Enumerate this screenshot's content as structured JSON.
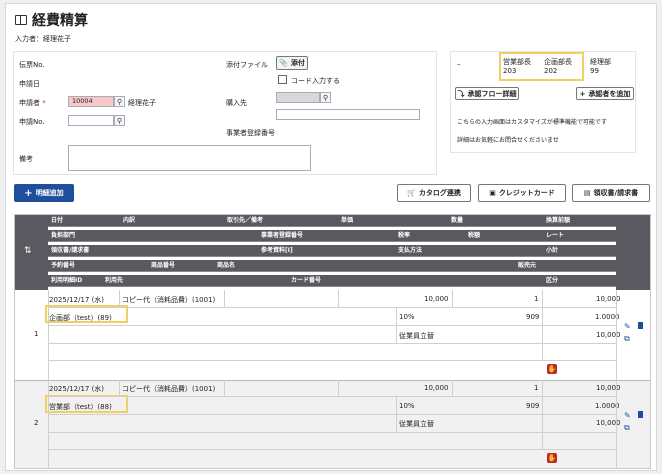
{
  "page": {
    "title": "経費精算",
    "entered_by": "入力者：経理花子"
  },
  "form": {
    "voucher_no_label": "伝票No.",
    "apply_date_label": "申請日",
    "applicant_label": "申請者",
    "required_mark": "*",
    "applicant_code": "10004",
    "applicant_name": "経理花子",
    "apply_no_label": "申請No.",
    "remarks_label": "備考",
    "attach_label": "添付ファイル",
    "attach_button": "添付",
    "code_input_label": "コード入力する",
    "supplier_label": "購入先",
    "business_reg_label": "事業者登録番号"
  },
  "approval": {
    "dash": "–",
    "approvers": [
      {
        "role": "営業部長",
        "code": "203"
      },
      {
        "role": "企画部長",
        "code": "202"
      },
      {
        "role": "経理部",
        "code": "99"
      }
    ],
    "flow_button": "承認フロー詳細",
    "add_button": "承認者を追加",
    "note1": "こちらの入力画面はカスタマイズが標準機能で可能です",
    "note2": "詳細はお気軽にお問合せくださいませ"
  },
  "toolbar": {
    "add_detail": "明細追加",
    "catalog": "カタログ連携",
    "credit": "クレジットカード",
    "receipt": "領収書/請求書"
  },
  "table": {
    "headers": {
      "r1": [
        "日付",
        "内訳",
        "取引先／備考",
        "単価",
        "数量",
        "換算前額"
      ],
      "r2": [
        "負担部門",
        "事業者登録番号",
        "税率",
        "税額",
        "レート"
      ],
      "r3": [
        "領収書/請求書",
        "参考資料[I]",
        "支払方法",
        "小計"
      ],
      "r4": [
        "予約番号",
        "商品番号",
        "商品名",
        "販売元"
      ],
      "r5": [
        "利用明細ID",
        "利用先",
        "カード番号",
        "区分"
      ]
    },
    "rows": [
      {
        "no": "1",
        "date": "2025/12/17 (水)",
        "item": "コピー代（消耗品費）(1001)",
        "unit_price": "10,000",
        "qty": "1",
        "pre_amount": "10,000",
        "dept": "企画部（test）(89)",
        "tax_rate": "10%",
        "tax": "909",
        "rate": "1.0000",
        "payment": "従業員立替",
        "subtotal": "10,000"
      },
      {
        "no": "2",
        "date": "2025/12/17 (水)",
        "item": "コピー代（消耗品費）(1001)",
        "unit_price": "10,000",
        "qty": "1",
        "pre_amount": "10,000",
        "dept": "営業部（test）(88)",
        "tax_rate": "10%",
        "tax": "909",
        "rate": "1.0000",
        "payment": "従業員立替",
        "subtotal": "10,000"
      }
    ]
  },
  "colors": {
    "primary": "#1f4e9c",
    "header": "#59595f",
    "highlight": "#f0d060",
    "required": "#d03030",
    "danger": "#c0282d"
  }
}
